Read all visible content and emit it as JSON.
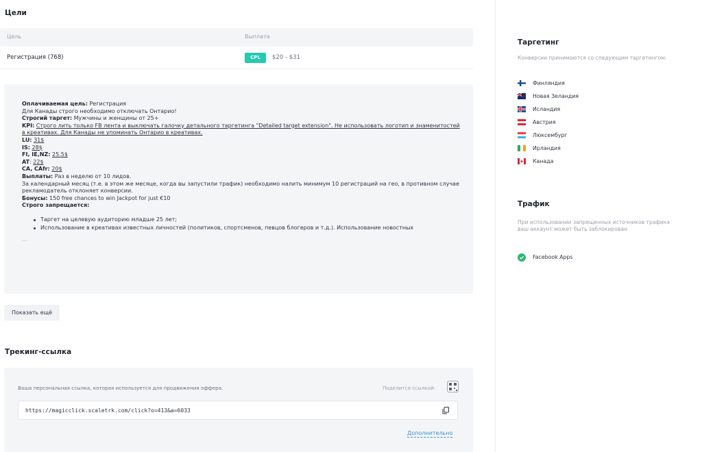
{
  "goals": {
    "title": "Цели",
    "col_goal": "Цель",
    "col_payout": "Выплата",
    "rows": [
      {
        "name": "Регистрация (768)",
        "badge": "CPL",
        "payout": "$20 - $31"
      }
    ]
  },
  "description": {
    "paid_goal_label": "Оплачиваемая цель:",
    "paid_goal_value": " Регистрация",
    "canada_note": "Для Канады строго необходимо отключать Онтарио!",
    "strict_target_label": "Строгий таргет:",
    "strict_target_value": " Мужчины и женщины от 25+",
    "kpi_label": "KPI:",
    "kpi_value": "Строго лить только FB лента и выключать галочку детального таргетинга \"Detailed target extension\". Не использовать логотип и знаменитостей в креативах. Для Канады не упоминать Онтарио в креативах.",
    "lu_label": "LU:",
    "lu_value": "31$",
    "is_label": "IS:",
    "is_value": "28$",
    "fi_label": "FI, IE,NZ:",
    "fi_value": "25.5$",
    "at_label": "AT",
    "at_value": "22$",
    "ca_label": "CA, CAfr:",
    "ca_value": "20$",
    "payouts_label": "Выплаты:",
    "payouts_value": " Раз в неделю от 10 лидов.",
    "monthly_note": "За календарный месяц (т.е. в этом же месяце, когда вы запустили трафик) необходимо налить минимум 10 регистраций на гео, в противном случае рекламодатель отклоняет конверсии.",
    "bonus_label": "Бонусы:",
    "bonus_value": " 150 free chances to win Jackpot for just €10",
    "forbidden_label": "Строго запрещается:",
    "forbidden_items": [
      "Таргет на целевую аудиторию младше 25 лет;",
      "Использование в креативах известных личностей (политиков, спортсменов, певцов блогеров и т.д.). Использование новостных"
    ],
    "ellipsis": "..."
  },
  "show_more_label": "Показать ещё",
  "tracking": {
    "title": "Трекинг-ссылка",
    "description": "Ваша персональная ссылка, которая используется для продвижения оффера.",
    "share_label": "Поделится ссылкой:",
    "url": "https://magicclick.scaletrk.com/click?o=413&a=6033",
    "more_label": "Дополнительно"
  },
  "targeting": {
    "title": "Таргетинг",
    "description": "Конверсии принимаются со следующим таргетингом:",
    "countries": [
      {
        "name": "Финляндия",
        "flag": "fi-flag-icon"
      },
      {
        "name": "Новая Зеландия",
        "flag": "nz-flag-icon"
      },
      {
        "name": "Исландия",
        "flag": "is-flag-icon"
      },
      {
        "name": "Австрия",
        "flag": "at-flag-icon"
      },
      {
        "name": "Люксембург",
        "flag": "lu-flag-icon"
      },
      {
        "name": "Ирландия",
        "flag": "ie-flag-icon"
      },
      {
        "name": "Канада",
        "flag": "ca-flag-icon"
      }
    ]
  },
  "traffic": {
    "title": "Трафик",
    "description": "При использовании запрещенных источников трафика ваш аккаунт может быть заблокирован",
    "allowed": [
      {
        "name": "Facebook Apps",
        "icon": "check-circle-icon"
      }
    ]
  },
  "colors": {
    "accent_teal": "#25c9b0",
    "link_blue": "#3a8fd6",
    "check_green": "#2fb870",
    "panel_bg": "#f4f5f7"
  }
}
